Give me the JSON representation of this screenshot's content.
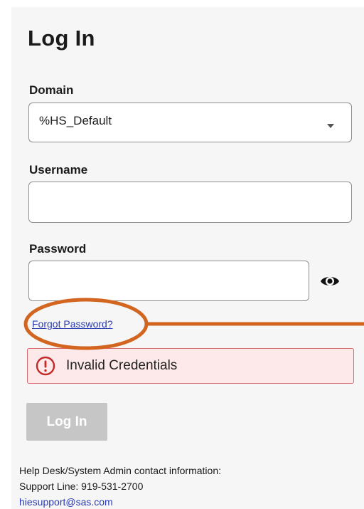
{
  "page": {
    "title": "Log In"
  },
  "form": {
    "domain": {
      "label": "Domain",
      "value": "%HS_Default"
    },
    "username": {
      "label": "Username",
      "value": "",
      "placeholder": ""
    },
    "password": {
      "label": "Password",
      "value": "",
      "placeholder": ""
    },
    "show_password_icon": "eye-icon",
    "forgot_password_label": "Forgot Password?",
    "error": {
      "icon": "exclamation-circle-icon",
      "message": "Invalid Credentials"
    },
    "submit_label": "Log In",
    "submit_disabled": true
  },
  "footer": {
    "heading": "Help Desk/System Admin contact information:",
    "support_line": "Support Line: 919-531-2700",
    "email": "hiesupport@sas.com"
  },
  "colors": {
    "panel_background": "#f6f6f6",
    "link": "#2b3bb0",
    "error_background": "#fde9e9",
    "error_border": "#d76a6a",
    "error_icon": "#c22a2a",
    "disabled_button": "#c6c6c6",
    "annotation_highlight": "#d2651f"
  }
}
